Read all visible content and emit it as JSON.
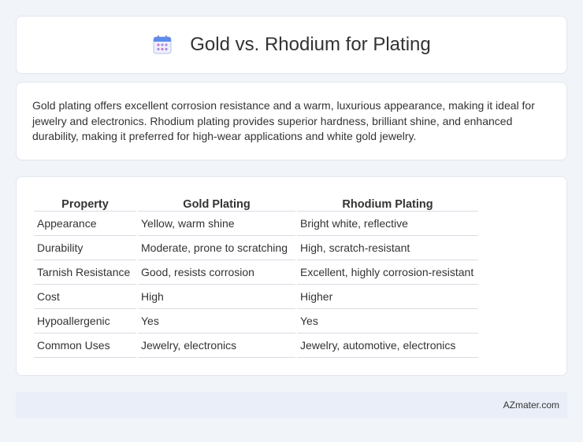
{
  "header": {
    "title": "Gold vs. Rhodium for Plating",
    "icon": "calendar-icon"
  },
  "description": "Gold plating offers excellent corrosion resistance and a warm, luxurious appearance, making it ideal for jewelry and electronics. Rhodium plating provides superior hardness, brilliant shine, and enhanced durability, making it preferred for high-wear applications and white gold jewelry.",
  "table": {
    "headers": [
      "Property",
      "Gold Plating",
      "Rhodium Plating"
    ],
    "rows": [
      [
        "Appearance",
        "Yellow, warm shine",
        "Bright white, reflective"
      ],
      [
        "Durability",
        "Moderate, prone to scratching",
        "High, scratch-resistant"
      ],
      [
        "Tarnish Resistance",
        "Good, resists corrosion",
        "Excellent, highly corrosion-resistant"
      ],
      [
        "Cost",
        "High",
        "Higher"
      ],
      [
        "Hypoallergenic",
        "Yes",
        "Yes"
      ],
      [
        "Common Uses",
        "Jewelry, electronics",
        "Jewelry, automotive, electronics"
      ]
    ]
  },
  "footer": {
    "site": "AZmater.com"
  }
}
